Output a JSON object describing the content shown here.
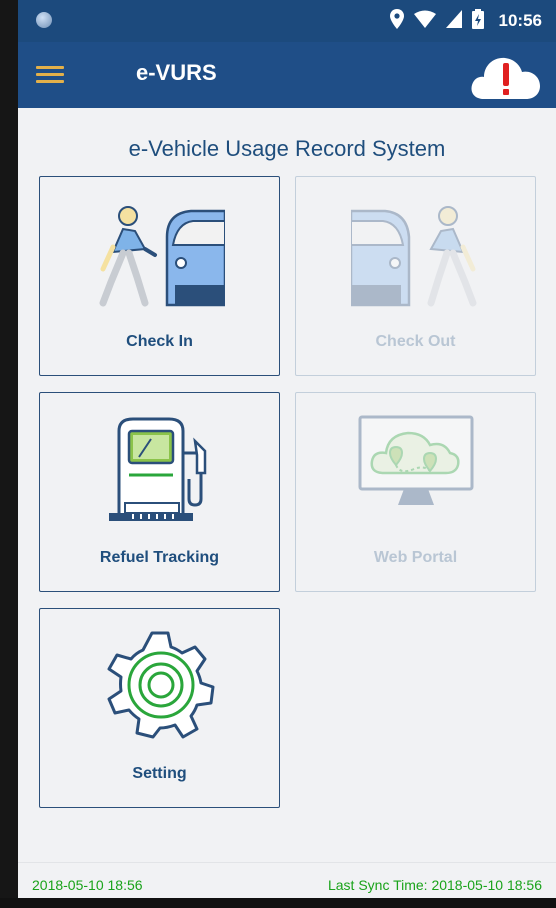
{
  "status_bar": {
    "time": "10:56"
  },
  "toolbar": {
    "title": "e-VURS",
    "menu_icon": "hamburger-menu-icon",
    "alert_icon": "cloud-alert-icon"
  },
  "page_title": "e-Vehicle Usage Record System",
  "tiles": [
    {
      "label": "Check In",
      "icon": "person-car-check-in-icon",
      "enabled": true
    },
    {
      "label": "Check Out",
      "icon": "car-person-check-out-icon",
      "enabled": false
    },
    {
      "label": "Refuel Tracking",
      "icon": "fuel-pump-icon",
      "enabled": true
    },
    {
      "label": "Web Portal",
      "icon": "monitor-cloud-map-icon",
      "enabled": false
    },
    {
      "label": "Setting",
      "icon": "gear-icon",
      "enabled": true
    }
  ],
  "footer": {
    "date": "2018-05-10 18:56",
    "sync": "Last Sync Time: 2018-05-10 18:56"
  },
  "colors": {
    "primary": "#1f4e87",
    "accent": "#e3b04a",
    "green": "#2aa63b",
    "alert": "#e02020"
  }
}
